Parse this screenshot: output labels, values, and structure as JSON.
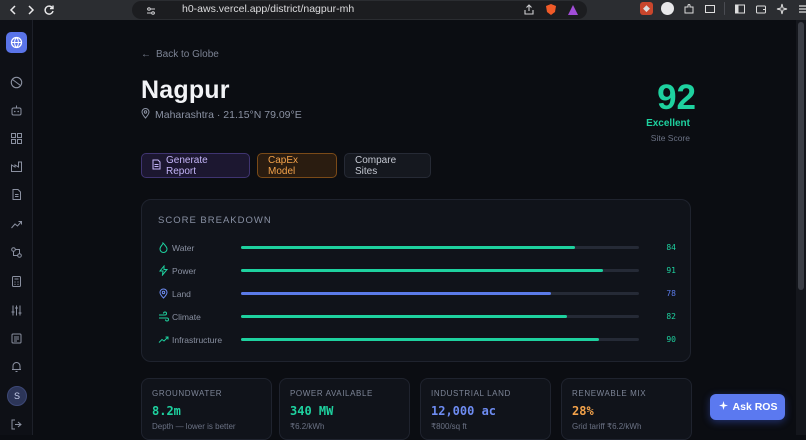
{
  "browser": {
    "url": "h0-aws.vercel.app/district/nagpur-mh"
  },
  "page": {
    "back_label": "Back to Globe",
    "city": "Nagpur",
    "location": "Maharashtra · 21.15°N 79.09°E",
    "score": "92",
    "score_label": "Excellent",
    "score_sub": "Site Score"
  },
  "actions": {
    "report": "Generate Report",
    "capex": "CapEx Model",
    "compare": "Compare Sites"
  },
  "breakdown": {
    "title": "SCORE BREAKDOWN",
    "rows": [
      {
        "label": "Water",
        "value": "84",
        "score": 84,
        "color": "#1ed19f",
        "icon": "water-icon"
      },
      {
        "label": "Power",
        "value": "91",
        "score": 91,
        "color": "#1ed19f",
        "icon": "bolt-icon"
      },
      {
        "label": "Land",
        "value": "78",
        "score": 78,
        "color": "#5b7be8",
        "icon": "map-pin-icon"
      },
      {
        "label": "Climate",
        "value": "82",
        "score": 82,
        "color": "#1ed19f",
        "icon": "wind-icon"
      },
      {
        "label": "Infrastructure",
        "value": "90",
        "score": 90,
        "color": "#1ed19f",
        "icon": "trend-up-icon"
      }
    ]
  },
  "stats": [
    {
      "label": "GROUNDWATER",
      "value": "8.2m",
      "note": "Depth — lower is better",
      "color": "#1ed19f"
    },
    {
      "label": "POWER AVAILABLE",
      "value": "340 MW",
      "note": "₹6.2/kWh",
      "color": "#1ed19f"
    },
    {
      "label": "INDUSTRIAL LAND",
      "value": "12,000 ac",
      "note": "₹800/sq ft",
      "color": "#6e8cf2"
    },
    {
      "label": "RENEWABLE MIX",
      "value": "28%",
      "note": "Grid tariff ₹6.2/kWh",
      "color": "#f3a24a"
    }
  ],
  "assistant": {
    "label": "Ask ROS"
  },
  "user": {
    "initial": "S"
  }
}
